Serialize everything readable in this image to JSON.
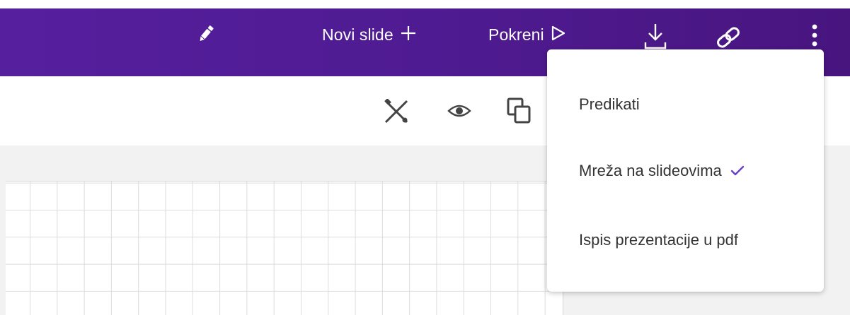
{
  "colors": {
    "topbar": "#4f1b92",
    "accent": "#6b3fc3",
    "icon_gray": "#444444",
    "grid_line": "#dcdcdc"
  },
  "topbar": {
    "new_slide_label": "Novi slide",
    "run_label": "Pokreni",
    "icons": [
      "pencil-icon",
      "plus-icon",
      "play-icon",
      "download-icon",
      "link-icon",
      "more-vertical-icon"
    ]
  },
  "toolbar": {
    "icons": [
      "tools-off-icon",
      "eye-icon",
      "duplicate-icon"
    ]
  },
  "menu": {
    "items": [
      {
        "label": "Predikati",
        "checked": false
      },
      {
        "label": "Mreža na slideovima",
        "checked": true
      },
      {
        "label": "Ispis prezentacije u pdf",
        "checked": false
      }
    ]
  }
}
